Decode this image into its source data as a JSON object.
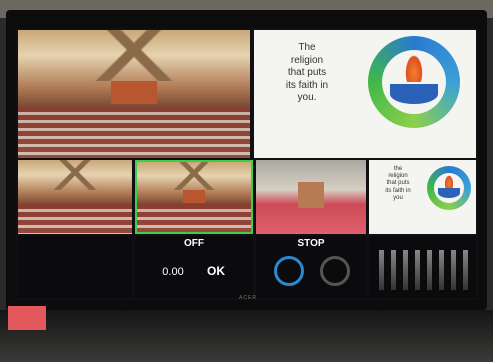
{
  "tiles": {
    "main_program_label": "",
    "preview_label": "",
    "cam1_label": "",
    "cam2_label": "",
    "cam3_label": "",
    "slide_label": ""
  },
  "slide": {
    "line1": "The",
    "line2": "religion",
    "line3": "that puts",
    "line4": "its faith in",
    "line5": "you."
  },
  "small_slide": {
    "line1": "the",
    "line2": "religion",
    "line3": "that puts",
    "line4": "its faith in",
    "line5": "you"
  },
  "record": {
    "status": "OFF",
    "time": "0.00",
    "ok": "OK"
  },
  "stream": {
    "status": "STOP"
  },
  "footer": {
    "left_text": "",
    "brand": "ACER"
  },
  "colors": {
    "accent": "#2a8ad0",
    "sticker": "#e2585d"
  }
}
